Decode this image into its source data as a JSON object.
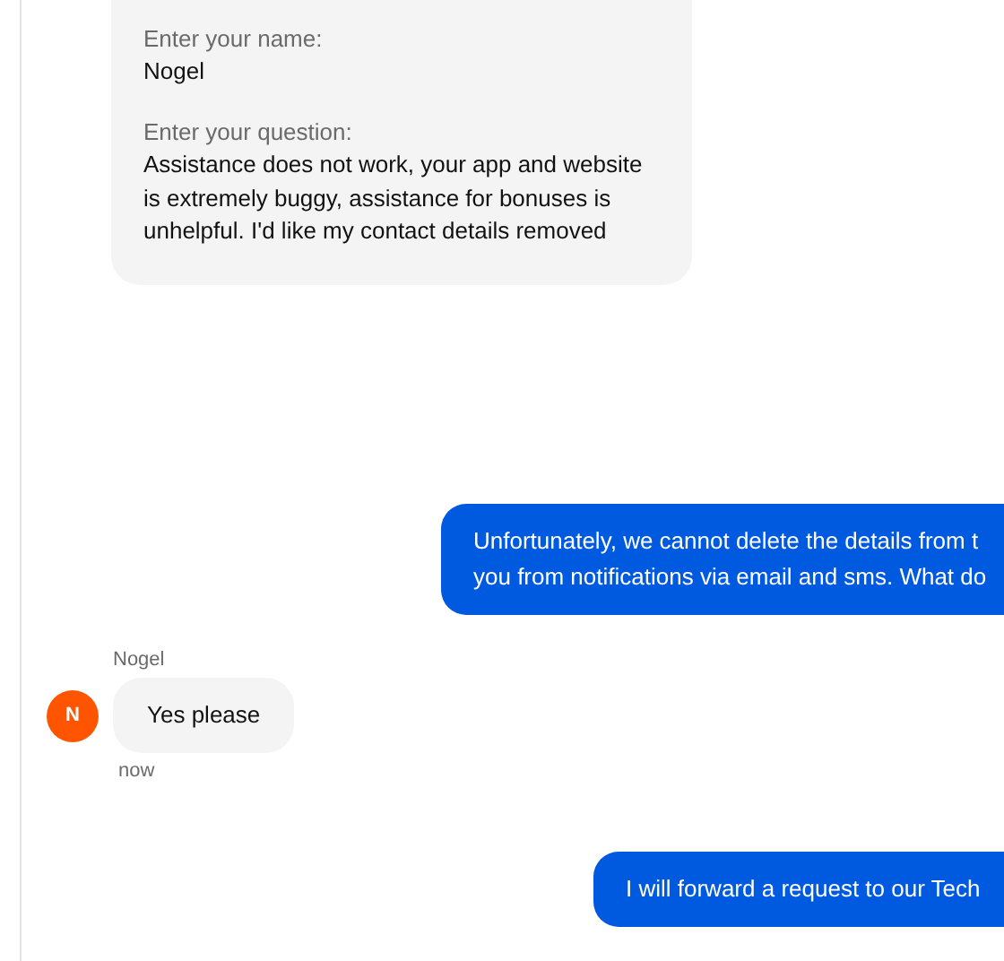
{
  "messages": [
    {
      "kind": "form",
      "fields": [
        {
          "label": "Enter your name:",
          "value": "Nogel"
        },
        {
          "label": "Enter your question:",
          "value": "Assistance does not work, your app and website is extremely buggy, assistance for bonuses is unhelpful. I'd like my contact details removed"
        }
      ]
    },
    {
      "kind": "outgoing",
      "lines": [
        "Unfortunately, we cannot delete the details from t",
        "you from notifications via email and sms. What do"
      ]
    },
    {
      "kind": "incoming",
      "sender": "Nogel",
      "avatar": "N",
      "text": "Yes please",
      "time": "now"
    },
    {
      "kind": "outgoing",
      "lines": [
        "I will forward a request to our Tech"
      ]
    }
  ]
}
